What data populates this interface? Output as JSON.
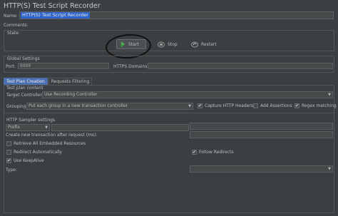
{
  "title": "HTTP(S) Test Script Recorder",
  "name": {
    "label": "Name:",
    "value": "HTTP(S) Test Script Recorder"
  },
  "comments": {
    "label": "Comments:"
  },
  "state": {
    "legend": "State",
    "start_label": "Start",
    "stop_label": "Stop",
    "restart_label": "Restart"
  },
  "global": {
    "legend": "Global Settings",
    "port_label": "Port:",
    "port_value": "8888",
    "https_label": "HTTPS Domains:",
    "https_value": ""
  },
  "tabs": [
    {
      "label": "Test Plan Creation",
      "active": true
    },
    {
      "label": "Requests Filtering",
      "active": false
    }
  ],
  "test_plan": {
    "legend": "Test plan content",
    "target_label": "Target Controller:",
    "target_value": "Use Recording Controller",
    "grouping_label": "Grouping:",
    "grouping_value": "Put each group in a new transaction controller",
    "capture_headers": {
      "label": "Capture HTTP Headers",
      "checked": true
    },
    "add_assertions": {
      "label": "Add Assertions",
      "checked": false
    },
    "regex_matching": {
      "label": "Regex matching",
      "checked": true
    }
  },
  "sampler": {
    "legend": "HTTP Sampler settings",
    "prefix_value": "Prefix",
    "create_tx_label": "Create new transaction after request (ms):",
    "retrieve_embedded": {
      "label": "Retrieve All Embedded Resources",
      "checked": false
    },
    "redirect_auto": {
      "label": "Redirect Automatically",
      "checked": false
    },
    "follow_redirects": {
      "label": "Follow Redirects",
      "checked": true
    },
    "use_keepalive": {
      "label": "Use KeepAlive",
      "checked": true
    },
    "type_label": "Type:",
    "type_value": ""
  },
  "colors": {
    "background": "#3c3f41",
    "accent": "#4b6eaf",
    "selection": "#2f65ca",
    "start_icon": "#4caf50"
  }
}
